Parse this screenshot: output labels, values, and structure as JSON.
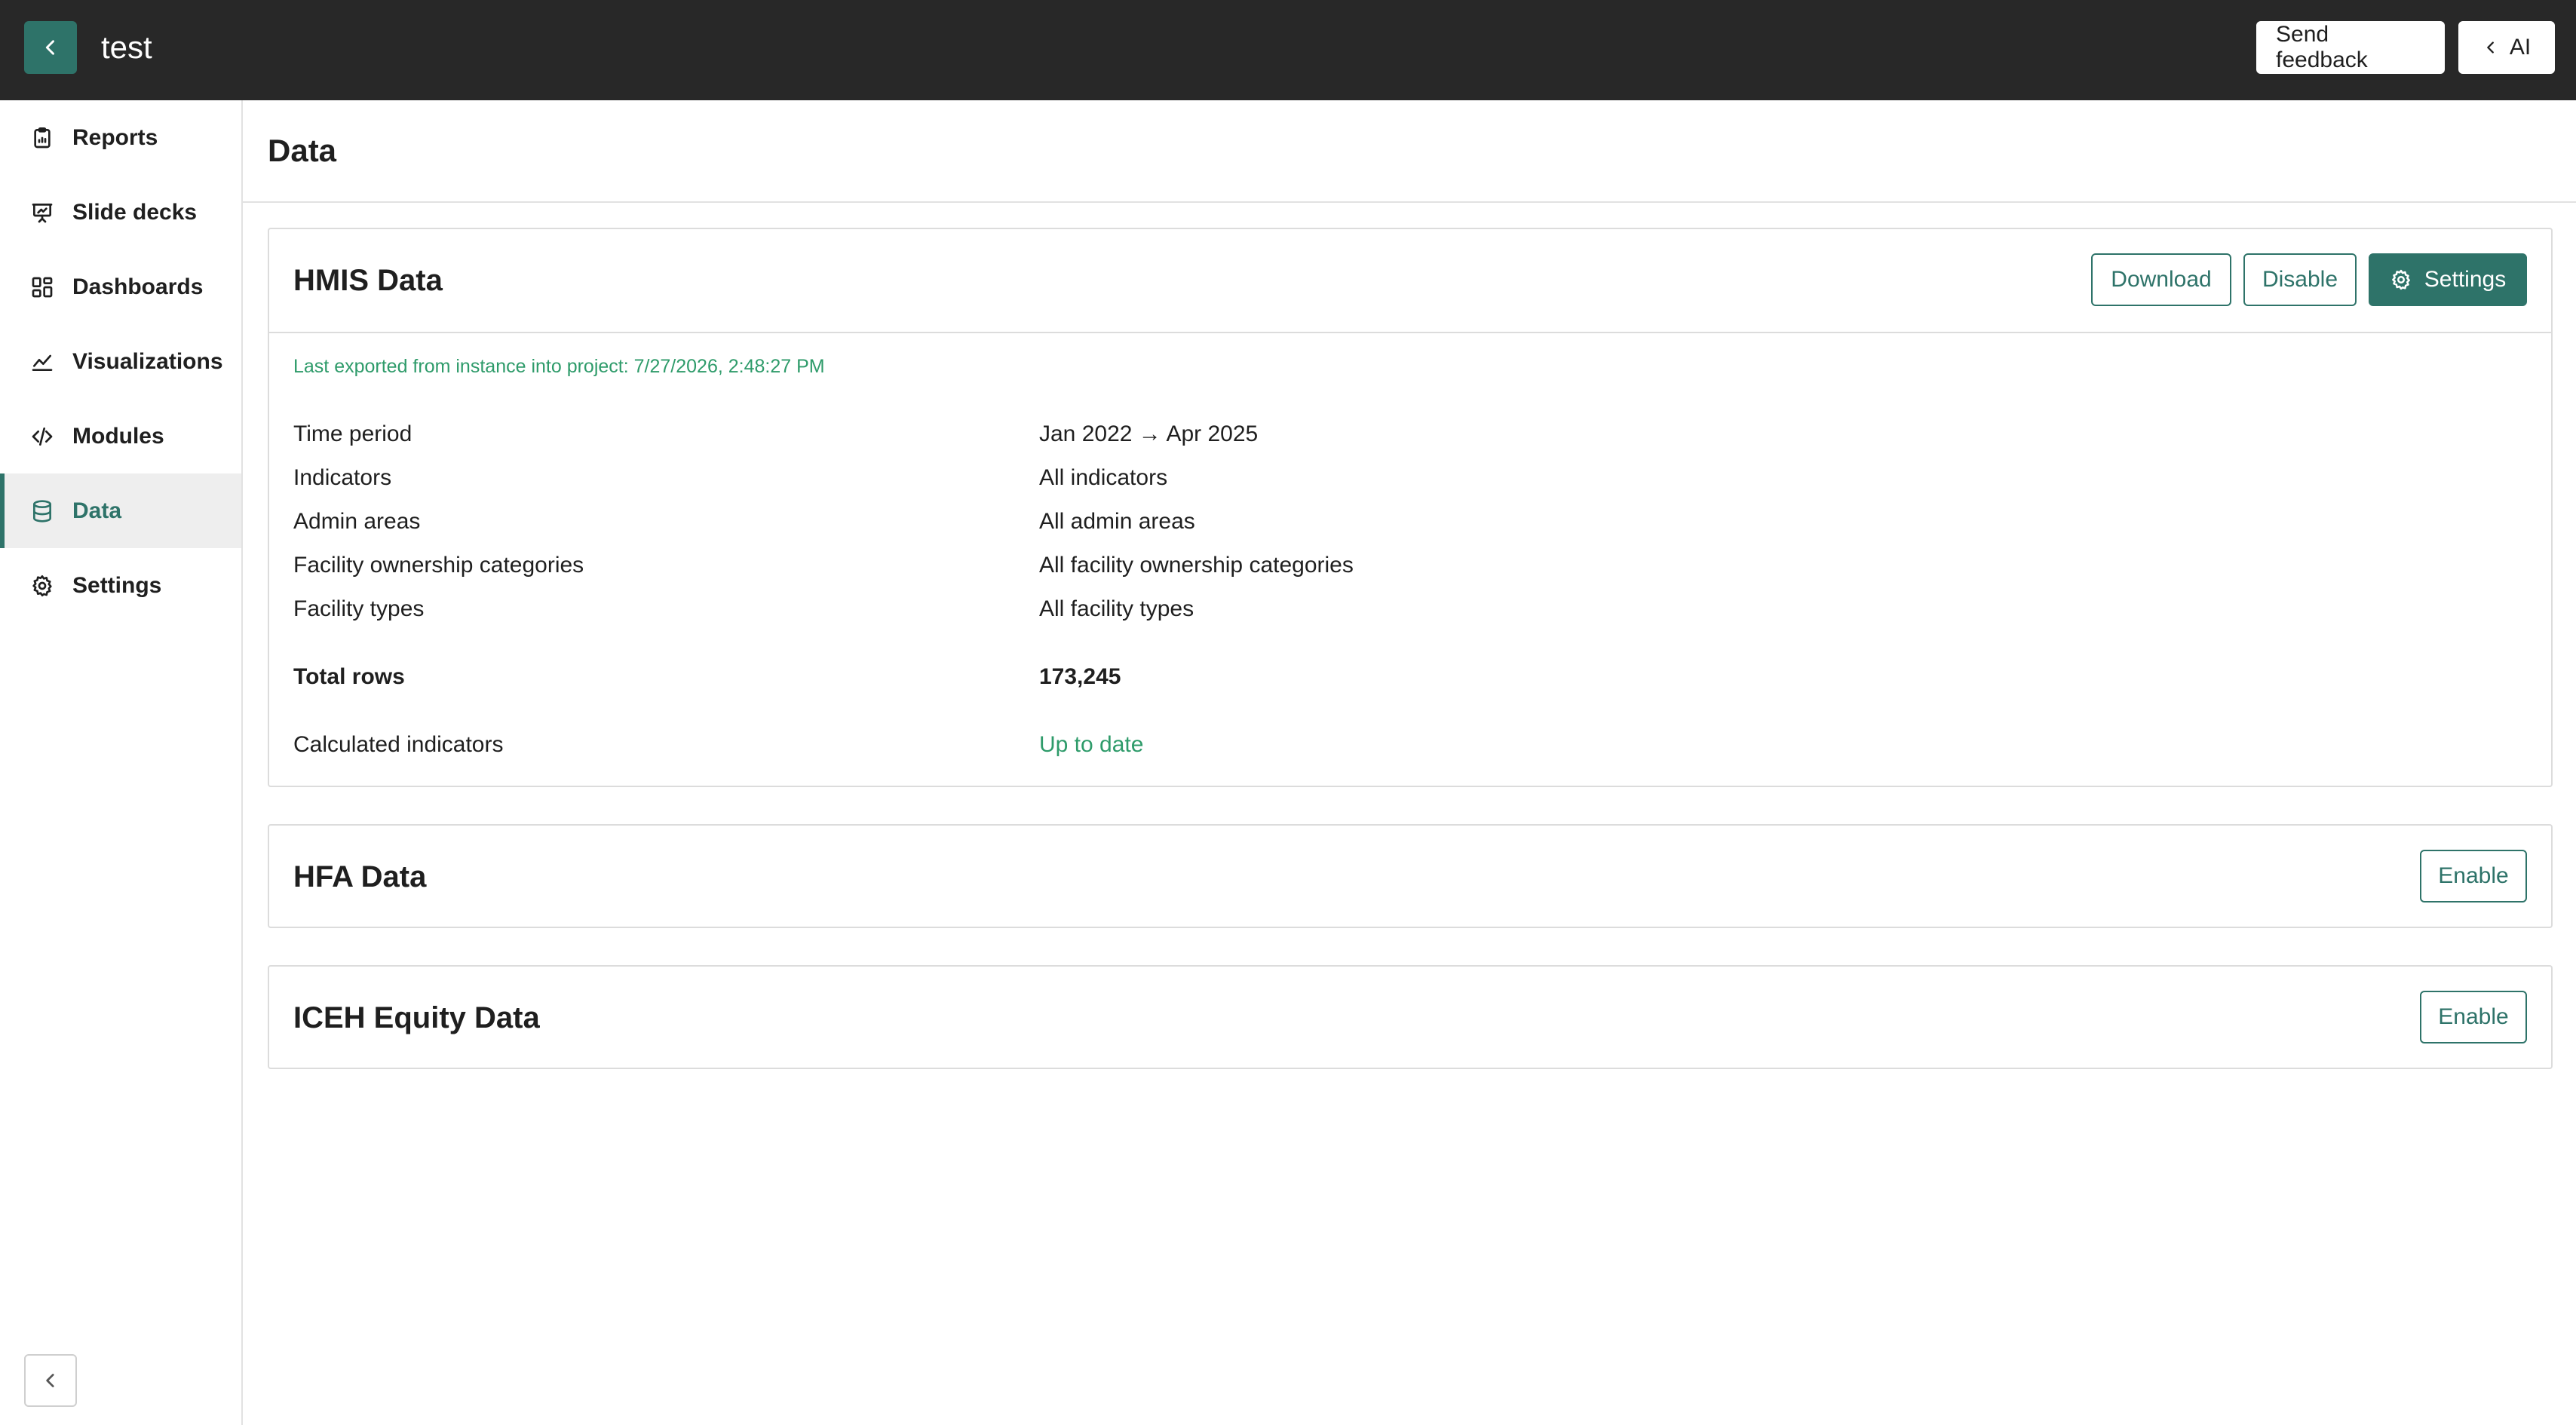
{
  "topbar": {
    "project_name": "test",
    "send_feedback_label": "Send feedback",
    "ai_label": "AI"
  },
  "sidebar": {
    "items": [
      {
        "label": "Reports",
        "icon": "clipboard-icon"
      },
      {
        "label": "Slide decks",
        "icon": "presentation-icon"
      },
      {
        "label": "Dashboards",
        "icon": "grid-icon"
      },
      {
        "label": "Visualizations",
        "icon": "line-chart-icon"
      },
      {
        "label": "Modules",
        "icon": "code-icon"
      },
      {
        "label": "Data",
        "icon": "database-icon",
        "active": true
      },
      {
        "label": "Settings",
        "icon": "gear-icon"
      }
    ]
  },
  "main": {
    "title": "Data",
    "hmis": {
      "title": "HMIS Data",
      "download_label": "Download",
      "disable_label": "Disable",
      "settings_label": "Settings",
      "export_note": "Last exported from instance into project: 7/27/2026, 2:48:27 PM",
      "rows": [
        {
          "key": "Time period",
          "value": "Jan 2022 → Apr 2025"
        },
        {
          "key": "Indicators",
          "value": "All indicators"
        },
        {
          "key": "Admin areas",
          "value": "All admin areas"
        },
        {
          "key": "Facility ownership categories",
          "value": "All facility ownership categories"
        },
        {
          "key": "Facility types",
          "value": "All facility types"
        }
      ],
      "total_rows_label": "Total rows",
      "total_rows_value": "173,245",
      "calculated_label": "Calculated indicators",
      "calculated_value": "Up to date"
    },
    "hfa": {
      "title": "HFA Data",
      "enable_label": "Enable"
    },
    "iceh": {
      "title": "ICEH Equity Data",
      "enable_label": "Enable"
    }
  },
  "colors": {
    "accent": "#2e7369",
    "success_text": "#2e9b6a",
    "topbar_bg": "#282828"
  }
}
